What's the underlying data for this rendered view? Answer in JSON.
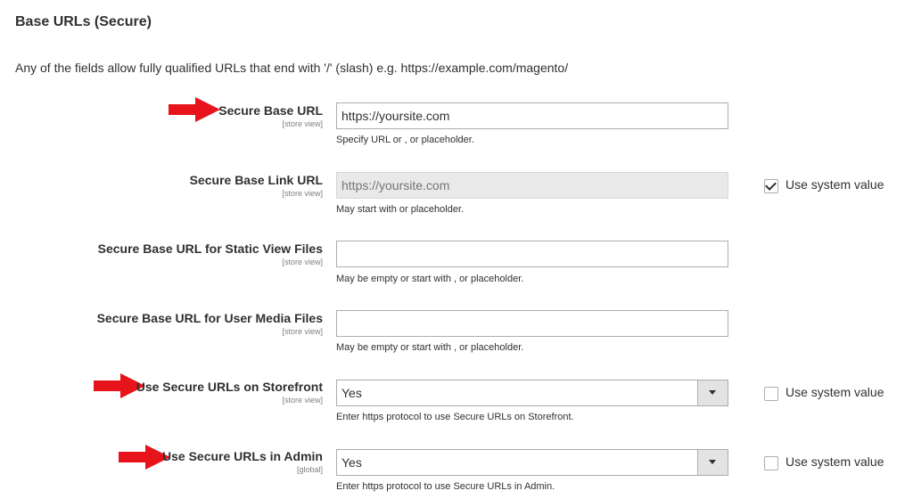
{
  "section": {
    "title": "Base URLs (Secure)",
    "description": "Any of the fields allow fully qualified URLs that end with '/' (slash) e.g. https://example.com/magento/"
  },
  "fields": {
    "secure_base_url": {
      "label": "Secure Base URL",
      "scope": "[store view]",
      "value": "https://yoursite.com",
      "note": "Specify URL or , or placeholder."
    },
    "secure_base_link_url": {
      "label": "Secure Base Link URL",
      "scope": "[store view]",
      "placeholder": "https://yoursite.com",
      "note": "May start with or placeholder.",
      "use_system_value": {
        "label": "Use system value",
        "checked": true
      }
    },
    "secure_static_url": {
      "label": "Secure Base URL for Static View Files",
      "scope": "[store view]",
      "value": "",
      "note": "May be empty or start with , or placeholder."
    },
    "secure_media_url": {
      "label": "Secure Base URL for User Media Files",
      "scope": "[store view]",
      "value": "",
      "note": "May be empty or start with , or placeholder."
    },
    "use_secure_storefront": {
      "label": "Use Secure URLs on Storefront",
      "scope": "[store view]",
      "selected": "Yes",
      "note": "Enter https protocol to use Secure URLs on Storefront.",
      "use_system_value": {
        "label": "Use system value",
        "checked": false
      }
    },
    "use_secure_admin": {
      "label": "Use Secure URLs in Admin",
      "scope": "[global]",
      "selected": "Yes",
      "note": "Enter https protocol to use Secure URLs in Admin.",
      "use_system_value": {
        "label": "Use system value",
        "checked": false
      }
    }
  },
  "colors": {
    "annotation_arrow": "#e8141b",
    "input_border": "#adadad",
    "disabled_bg": "#e9e9e9"
  },
  "icons": {
    "arrow": "red-arrow-right-icon",
    "select": "chevron-down-icon",
    "checkbox": "checkmark-icon"
  }
}
